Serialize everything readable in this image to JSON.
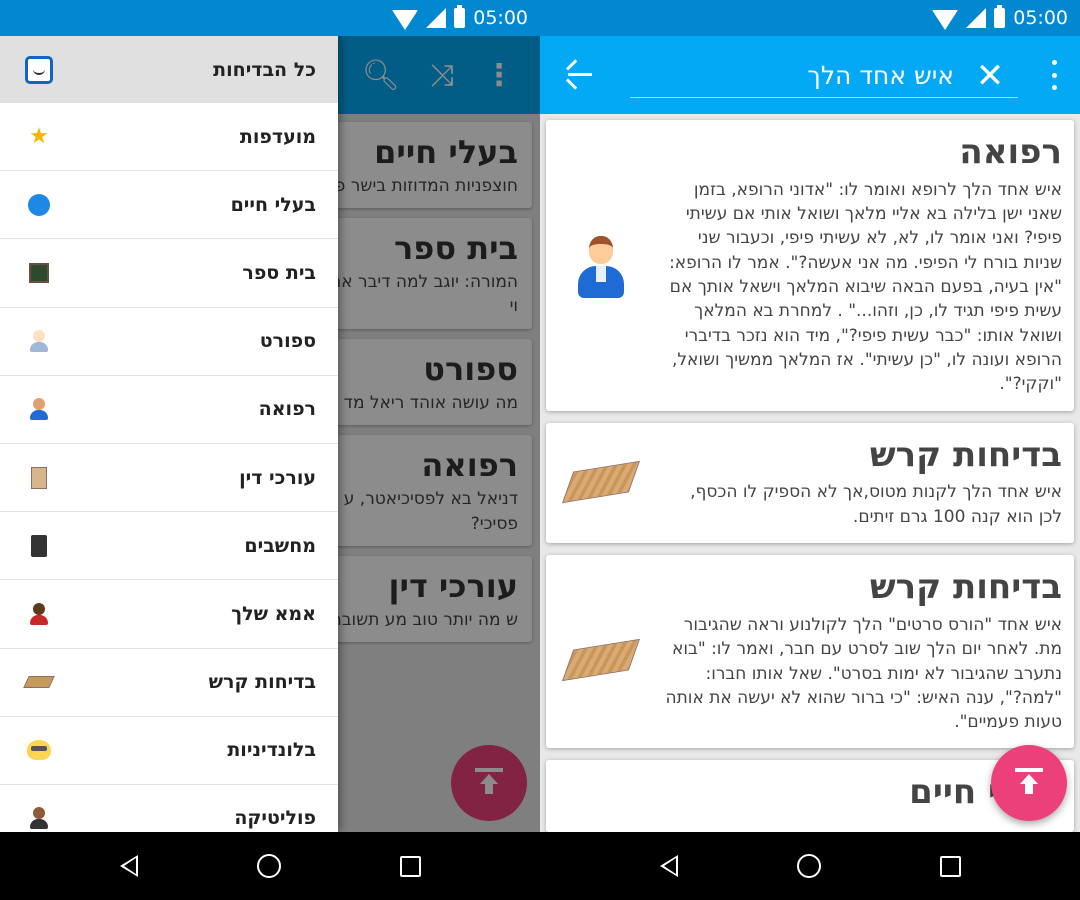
{
  "status": {
    "time": "05:00"
  },
  "left": {
    "toolbar": {
      "search_icon": "search-icon",
      "shuffle_icon": "shuffle-icon",
      "menu_icon": "more-vert-icon"
    },
    "bg_cards": [
      {
        "title": "בעלי חיים",
        "text": "חוצפניות המדוזות בישר פה דיסקים. הן רק צרב"
      },
      {
        "title": "בית ספר",
        "text": "המורה: יוגב למה דיבר אתה שוב מדבר? עוד מ בעצמך אמרת שמינוס וי"
      },
      {
        "title": "ספורט",
        "text": "מה עושה אוהד ריאל מד בסופר קלסיקו? מכבה א"
      },
      {
        "title": "רפואה",
        "text": "דניאל בא לפסיכיאטר, ע דניאל,אפשר לקרוא לך יכול לקרוא לך פסיכי?"
      },
      {
        "title": "עורכי דין",
        "text": "ש מה יותר טוב מע תשובה: עורך ד ..."
      }
    ],
    "drawer": {
      "header": "כל הבדיחות",
      "items": [
        {
          "label": "מועדפות",
          "icon": "star-icon"
        },
        {
          "label": "בעלי חיים",
          "icon": "bird-icon"
        },
        {
          "label": "בית ספר",
          "icon": "chalkboard-icon"
        },
        {
          "label": "ספורט",
          "icon": "athlete-icon"
        },
        {
          "label": "רפואה",
          "icon": "doctor-icon"
        },
        {
          "label": "עורכי דין",
          "icon": "document-icon"
        },
        {
          "label": "מחשבים",
          "icon": "computer-icon"
        },
        {
          "label": "אמא שלך",
          "icon": "woman-icon"
        },
        {
          "label": "בדיחות קרש",
          "icon": "plank-icon"
        },
        {
          "label": "בלונדיניות",
          "icon": "blonde-icon"
        },
        {
          "label": "פוליטיקה",
          "icon": "politician-icon"
        }
      ]
    }
  },
  "right": {
    "search": {
      "query": "איש אחד הלך"
    },
    "cards": [
      {
        "title": "רפואה",
        "icon": "doctor-icon",
        "text": "איש אחד הלך לרופא ואומר לו: \"אדוני הרופא, בזמן שאני ישן בלילה בא אליי מלאך ושואל אותי אם עשיתי פיפי? ואני אומר לו, לא, לא עשיתי פיפי, וכעבור שני שניות בורח לי הפיפי. מה אני אעשה?\". אמר לו הרופא: \"אין בעיה, בפעם הבאה שיבוא המלאך וישאל אותך אם עשית פיפי תגיד לו, כן, וזהו...\" . למחרת בא המלאך ושואל אותו: \"כבר עשית פיפי?\", מיד הוא נזכר בדיברי הרופא ועונה לו, \"כן עשיתי\". אז המלאך ממשיך ושואל, \"וקקי?\"."
      },
      {
        "title": "בדיחות קרש",
        "icon": "plank-icon",
        "text": "איש אחד הלך לקנות מטוס,אך לא הספיק לו הכסף, לכן הוא קנה 100 גרם זיתים."
      },
      {
        "title": "בדיחות קרש",
        "icon": "plank-icon",
        "text": "איש אחד \"הורס סרטים\" הלך לקולנוע וראה שהגיבור מת. לאחר יום הלך שוב לסרט עם חבר, ואמר לו: \"בוא נתערב שהגיבור לא ימות בסרט\". שאל אותו חברו: \"למה?\", ענה האיש: \"כי ברור שהוא לא יעשה את אותה טעות פעמיים\"."
      },
      {
        "title": "בעלי חיים",
        "icon": "",
        "text": ""
      }
    ]
  }
}
